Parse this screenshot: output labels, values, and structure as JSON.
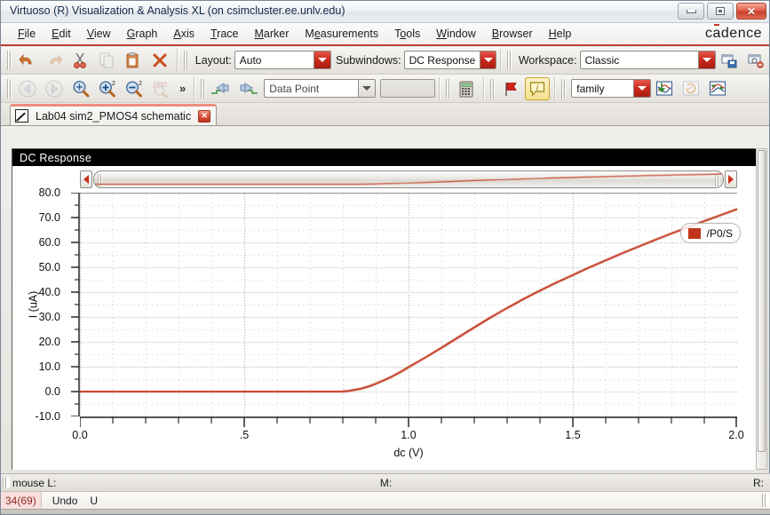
{
  "window": {
    "title": "Virtuoso (R) Visualization & Analysis XL (on csimcluster.ee.unlv.edu)",
    "buttons": {
      "minimize": "minimize-button",
      "restore": "restore-button",
      "close": "✕"
    }
  },
  "brand": {
    "pre": "c",
    "accent": "ā",
    "post": "dence",
    "accent_color": "#c0392b"
  },
  "menu": [
    {
      "pre": "",
      "key": "F",
      "post": "ile"
    },
    {
      "pre": "",
      "key": "E",
      "post": "dit"
    },
    {
      "pre": "",
      "key": "V",
      "post": "iew"
    },
    {
      "pre": "",
      "key": "G",
      "post": "raph"
    },
    {
      "pre": "",
      "key": "A",
      "post": "xis"
    },
    {
      "pre": "",
      "key": "T",
      "post": "race"
    },
    {
      "pre": "",
      "key": "M",
      "post": "arker"
    },
    {
      "pre": "M",
      "key": "e",
      "post": "asurements"
    },
    {
      "pre": "T",
      "key": "o",
      "post": "ols"
    },
    {
      "pre": "",
      "key": "W",
      "post": "indow"
    },
    {
      "pre": "",
      "key": "B",
      "post": "rowser"
    },
    {
      "pre": "",
      "key": "H",
      "post": "elp"
    }
  ],
  "toolbar_edit": {
    "icons": [
      "undo-icon",
      "redo-icon",
      "cut-icon",
      "copy-icon",
      "paste-icon",
      "delete-icon"
    ],
    "layout_label": "Layout:",
    "layout_value": "Auto",
    "subwindows_label": "Subwindows:",
    "subwindows_value": "DC Response",
    "workspace_label": "Workspace:",
    "workspace_value": "Classic",
    "save_workspace_icon": "save-workspace-icon",
    "delete_workspace_icon": "delete-workspace-icon"
  },
  "toolbar_zoom": {
    "icons": [
      "zoom-previous-icon",
      "zoom-next-icon",
      "zoom-fit-icon",
      "zoom-in-icon",
      "zoom-out-icon",
      "zoom-waveform-icon"
    ],
    "overflow": "»",
    "marker_prev_icon": "marker-previous-icon",
    "marker_next_icon": "marker-next-icon",
    "marker_mode_value": "Data Point",
    "marker_field_value": "",
    "calculator_icon": "calculator-icon",
    "flag_icon": "flag-marker-icon",
    "annotation_icon": "annotation-info-icon",
    "family_value": "family",
    "trace_icons": [
      "send-to-trace-icon",
      "swap-trace-icon",
      "split-trace-icon"
    ]
  },
  "tab": {
    "icon": "waveform-graph-icon",
    "label": "Lab04 sim2_PMOS4 schematic",
    "close": "✕"
  },
  "subwindow": {
    "title": "DC Response"
  },
  "scrollbars": {
    "h_left_arrow": "scroll-left-arrow-icon",
    "h_right_arrow": "scroll-right-arrow-icon"
  },
  "status": {
    "mouse_label": "mouse L:",
    "middle_label": "M:",
    "right_label": "R:",
    "command_count": "34(69)",
    "command_name": "Undo",
    "command_key": "U"
  },
  "chart_data": {
    "type": "line",
    "title": "DC Response",
    "xlabel": "dc (V)",
    "ylabel": "I (uA)",
    "xlim": [
      0.0,
      2.0
    ],
    "ylim": [
      -10.0,
      80.0
    ],
    "grid": true,
    "x_ticks": [
      0.0,
      0.5,
      1.0,
      1.5,
      2.0
    ],
    "x_tick_labels": [
      "0.0",
      ".5",
      "1.0",
      "1.5",
      "2.0"
    ],
    "x_minor_per_major": 5,
    "y_ticks": [
      -10.0,
      0.0,
      10.0,
      20.0,
      30.0,
      40.0,
      50.0,
      60.0,
      70.0,
      80.0
    ],
    "y_tick_labels": [
      "-10.0",
      "0.0",
      "10.0",
      "20.0",
      "30.0",
      "40.0",
      "50.0",
      "60.0",
      "70.0",
      "80.0"
    ],
    "legend_position": "top-right",
    "series": [
      {
        "name": "/P0/S",
        "color": "#c1351b",
        "x": [
          0.0,
          0.05,
          0.1,
          0.15,
          0.2,
          0.25,
          0.3,
          0.35,
          0.4,
          0.45,
          0.5,
          0.55,
          0.6,
          0.65,
          0.7,
          0.75,
          0.8,
          0.82,
          0.85,
          0.88,
          0.9,
          0.93,
          0.95,
          0.98,
          1.0,
          1.05,
          1.1,
          1.15,
          1.2,
          1.25,
          1.3,
          1.35,
          1.4,
          1.45,
          1.5,
          1.55,
          1.6,
          1.65,
          1.7,
          1.75,
          1.8,
          1.85,
          1.9,
          1.95,
          2.0
        ],
        "y": [
          0.0,
          0.0,
          0.0,
          0.0,
          0.0,
          0.0,
          0.0,
          0.0,
          0.0,
          0.0,
          0.0,
          0.0,
          0.0,
          0.0,
          0.0,
          0.0,
          0.05,
          0.3,
          1.0,
          2.1,
          3.1,
          4.8,
          6.1,
          8.2,
          9.8,
          13.6,
          17.6,
          21.7,
          25.8,
          29.8,
          33.6,
          37.2,
          40.6,
          43.8,
          46.9,
          49.9,
          52.8,
          55.6,
          58.3,
          61.0,
          63.6,
          66.1,
          68.6,
          71.0,
          73.4
        ]
      }
    ]
  }
}
